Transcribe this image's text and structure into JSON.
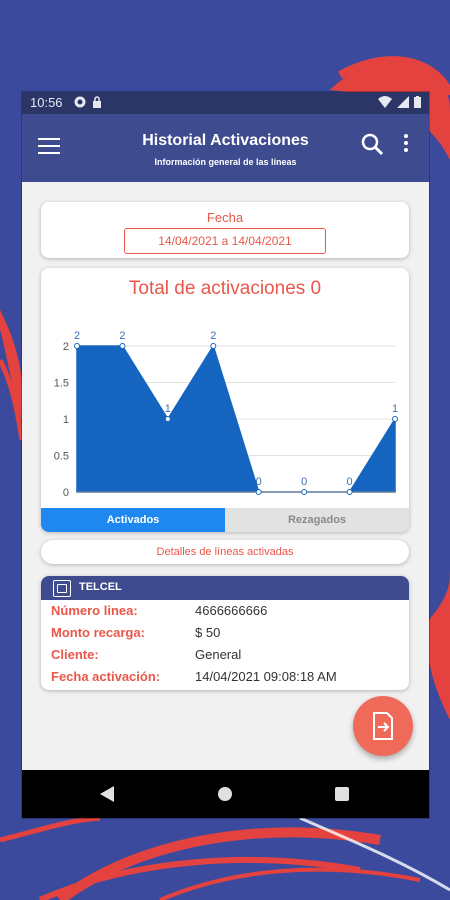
{
  "status_bar": {
    "time": "10:56"
  },
  "app_bar": {
    "title": "Historial Activaciones",
    "subtitle": "Información general de las líneas"
  },
  "date_filter": {
    "label": "Fecha",
    "range": "14/04/2021 a 14/04/2021"
  },
  "chart_data": {
    "type": "area",
    "title": "Total de activaciones 0",
    "x": [
      1,
      2,
      3,
      4,
      5,
      6,
      7,
      8
    ],
    "values": [
      2,
      2,
      1,
      2,
      0,
      0,
      0,
      1
    ],
    "data_labels": [
      "2",
      "2",
      "1",
      "2",
      "0",
      "0",
      "0",
      "1"
    ],
    "ylim": [
      0,
      2
    ],
    "yticks": [
      "0",
      "0.5",
      "1",
      "1.5",
      "2"
    ],
    "grid": true,
    "color": "#1565c0"
  },
  "tabs": [
    {
      "label": "Activados",
      "active": true
    },
    {
      "label": "Rezagados",
      "active": false
    }
  ],
  "details_button": "Detalles de líneas activadas",
  "line_card": {
    "carrier": "TELCEL",
    "rows": [
      {
        "label": "Número linea:",
        "value": "4666666666"
      },
      {
        "label": "Monto recarga:",
        "value": "$ 50"
      },
      {
        "label": "Cliente:",
        "value": "General"
      },
      {
        "label": "Fecha activación:",
        "value": "14/04/2021 09:08:18 AM"
      }
    ]
  },
  "colors": {
    "primary": "#3e4b8e",
    "accent": "#e8574a",
    "tab_active": "#1e88f0",
    "fab": "#ef6a59"
  },
  "icons": {
    "menu": "menu-icon",
    "search": "search-icon",
    "more": "more-vert-icon",
    "sim": "sim-card-icon",
    "fab": "export-file-icon"
  }
}
